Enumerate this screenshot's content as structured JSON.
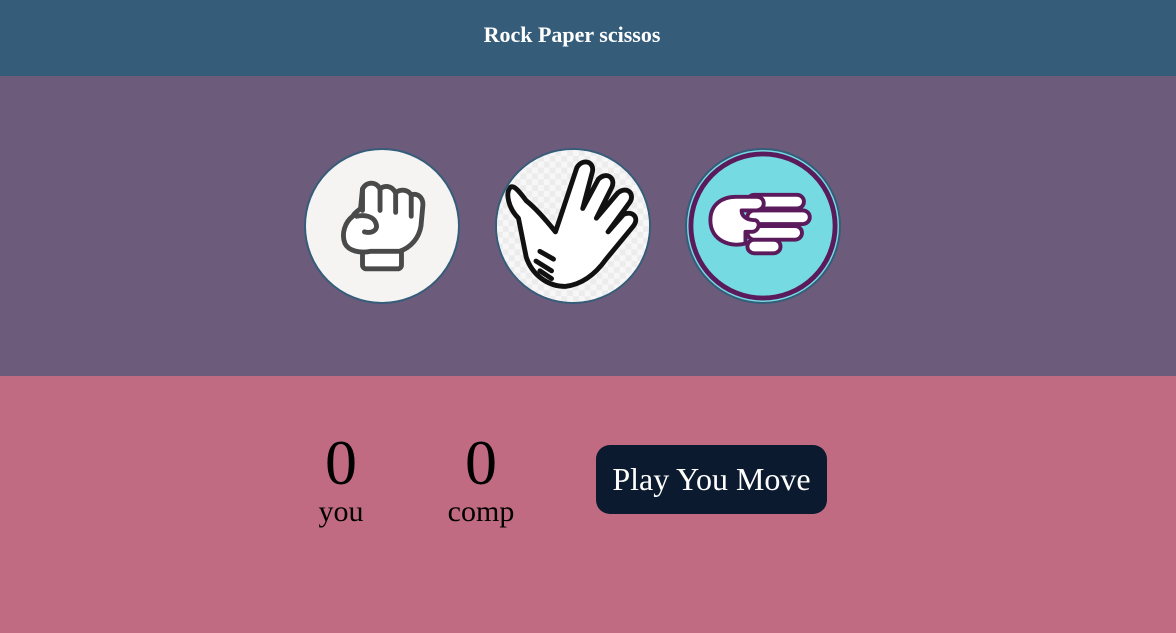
{
  "header": {
    "title": "Rock Paper scissos"
  },
  "choices": [
    {
      "id": "rock",
      "icon": "fist-icon",
      "bg": "#f5f4f2"
    },
    {
      "id": "paper",
      "icon": "open-hand-icon",
      "bg": "#f6f6f6"
    },
    {
      "id": "scissors",
      "icon": "scissors-hand-icon",
      "bg": "#76dae2"
    }
  ],
  "scoreboard": {
    "user": {
      "score": "0",
      "label": "you"
    },
    "comp": {
      "score": "0",
      "label": "comp"
    }
  },
  "play_button": {
    "label": "Play You Move"
  },
  "colors": {
    "header": "#355d7a",
    "choices_bg": "#6c5b7b",
    "scores_bg": "#c06b81",
    "button": "#0c1a30"
  }
}
